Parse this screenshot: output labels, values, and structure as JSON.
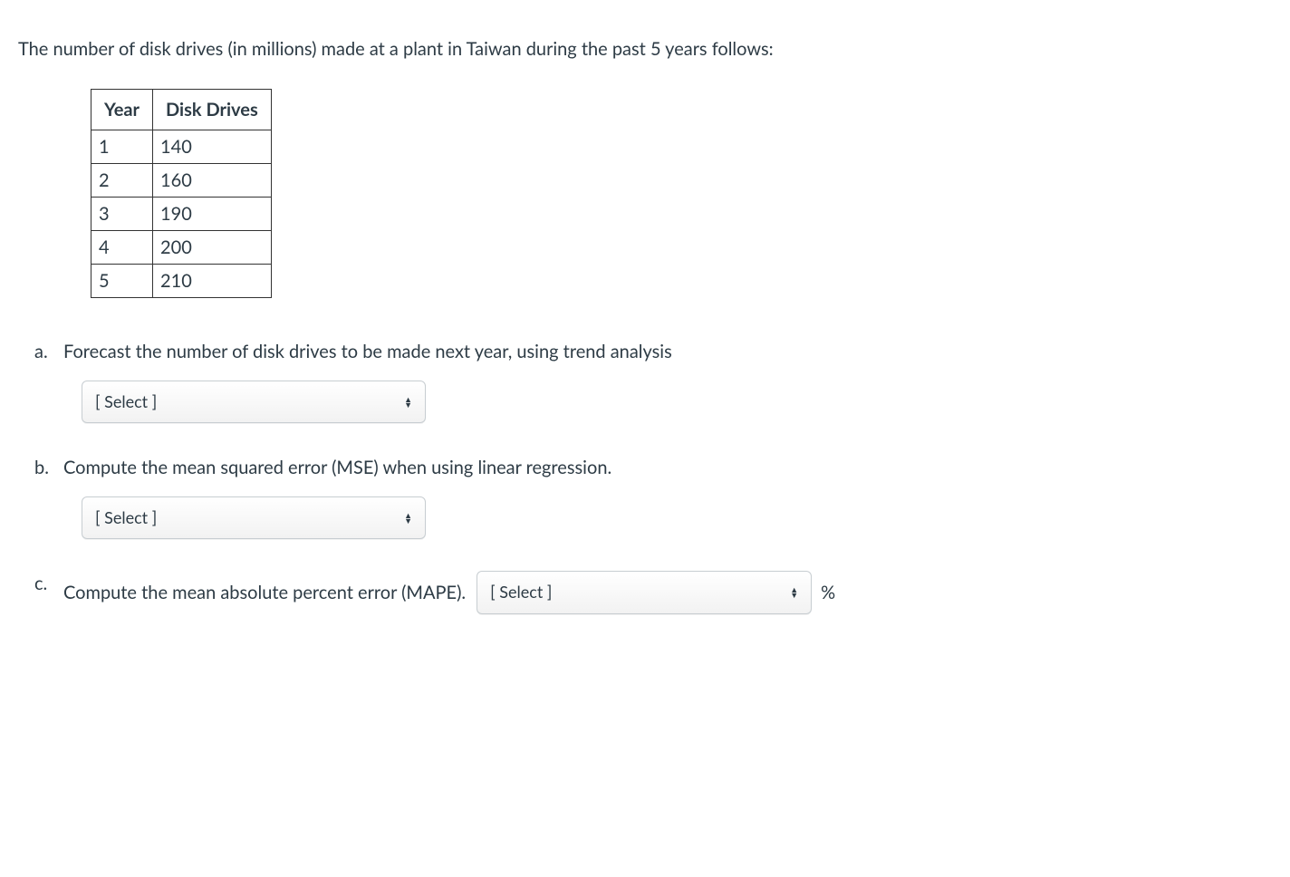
{
  "intro": "The number of disk drives (in millions) made at a plant in Taiwan during the past 5 years follows:",
  "table": {
    "headers": [
      "Year",
      "Disk Drives"
    ],
    "rows": [
      [
        "1",
        "140"
      ],
      [
        "2",
        "160"
      ],
      [
        "3",
        "190"
      ],
      [
        "4",
        "200"
      ],
      [
        "5",
        "210"
      ]
    ]
  },
  "questions": {
    "a": {
      "marker": "a.",
      "text": "Forecast the number of disk drives to be made next year, using trend analysis",
      "select_label": "[ Select ]"
    },
    "b": {
      "marker": "b.",
      "text": "Compute the mean squared error (MSE) when using linear regression.",
      "select_label": "[ Select ]"
    },
    "c": {
      "marker": "c.",
      "text": "Compute the mean absolute percent error (MAPE).",
      "select_label": "[ Select ]",
      "suffix": "%"
    }
  }
}
